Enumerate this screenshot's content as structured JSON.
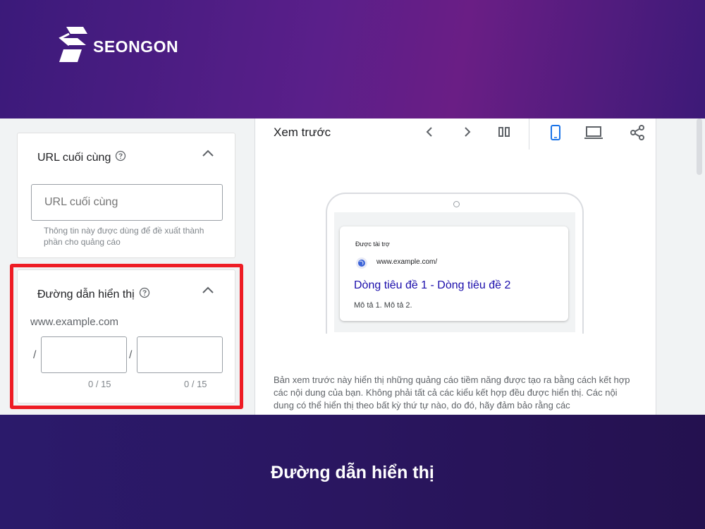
{
  "brand": {
    "name": "SEONGON"
  },
  "caption": "Đường dẫn hiển thị",
  "final_url_card": {
    "title": "URL cuối cùng",
    "input_placeholder": "URL cuối cùng",
    "hint": "Thông tin này được dùng để đề xuất thành phần cho quảng cáo"
  },
  "display_path_card": {
    "title": "Đường dẫn hiển thị",
    "domain": "www.example.com",
    "path1_counter": "0 / 15",
    "path2_counter": "0 / 15"
  },
  "preview": {
    "title": "Xem trước",
    "ad": {
      "sponsored_label": "Được tài trợ",
      "url": "www.example.com/",
      "headline": "Dòng tiêu đề 1 - Dòng tiêu đề 2",
      "description": "Mô tả 1. Mô tả 2."
    },
    "disclaimer": "Bản xem trước này hiển thị những quảng cáo tiềm năng được tạo ra bằng cách kết hợp các nội dung của bạn. Không phải tất cả các kiểu kết hợp đều được hiển thị. Các nội dung có thể hiển thị theo bất kỳ thứ tự nào, do đó, hãy đảm bảo rằng các"
  },
  "icons": {
    "help": "help-circle-icon",
    "collapse": "chevron-up-icon",
    "prev": "chevron-left-icon",
    "next": "chevron-right-icon",
    "columns": "columns-icon",
    "mobile": "mobile-icon",
    "desktop": "laptop-icon",
    "share": "share-icon",
    "globe": "globe-icon"
  },
  "colors": {
    "highlight": "#ee1c24",
    "headline": "#1a0dab",
    "active_icon": "#1a73e8"
  }
}
